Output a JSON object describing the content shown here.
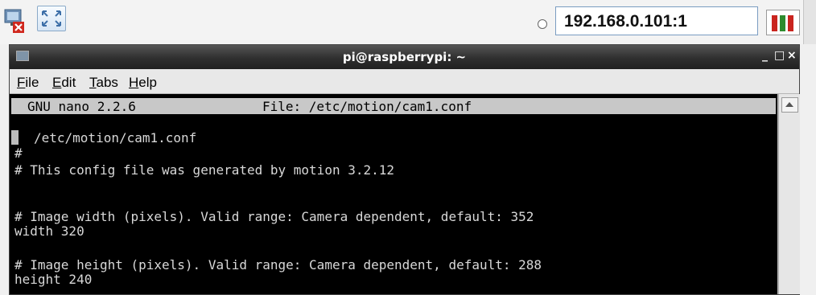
{
  "vnc": {
    "host": "192.168.0.101:1"
  },
  "window": {
    "title": "pi@raspberrypi: ~",
    "buttons": {
      "minimize": "_",
      "maximize": "□",
      "close": "×"
    }
  },
  "menu": {
    "items": [
      {
        "underline": "F",
        "rest": "ile"
      },
      {
        "underline": "E",
        "rest": "dit"
      },
      {
        "underline": "T",
        "rest": "abs"
      },
      {
        "underline": "H",
        "rest": "elp"
      }
    ]
  },
  "nano": {
    "version": "GNU nano 2.2.6",
    "file": "File: /etc/motion/cam1.conf"
  },
  "lines": [
    "/etc/motion/cam1.conf",
    "#",
    "# This config file was generated by motion 3.2.12",
    "# Image width (pixels). Valid range: Camera dependent, default: 352",
    "width 320",
    "# Image height (pixels). Valid range: Camera dependent, default: 288",
    "height 240"
  ],
  "colors": {
    "indicator_red": "#c9241e",
    "indicator_green": "#2e8b2e",
    "terminal_bg": "#000000",
    "terminal_fg": "#d8d8d8"
  }
}
